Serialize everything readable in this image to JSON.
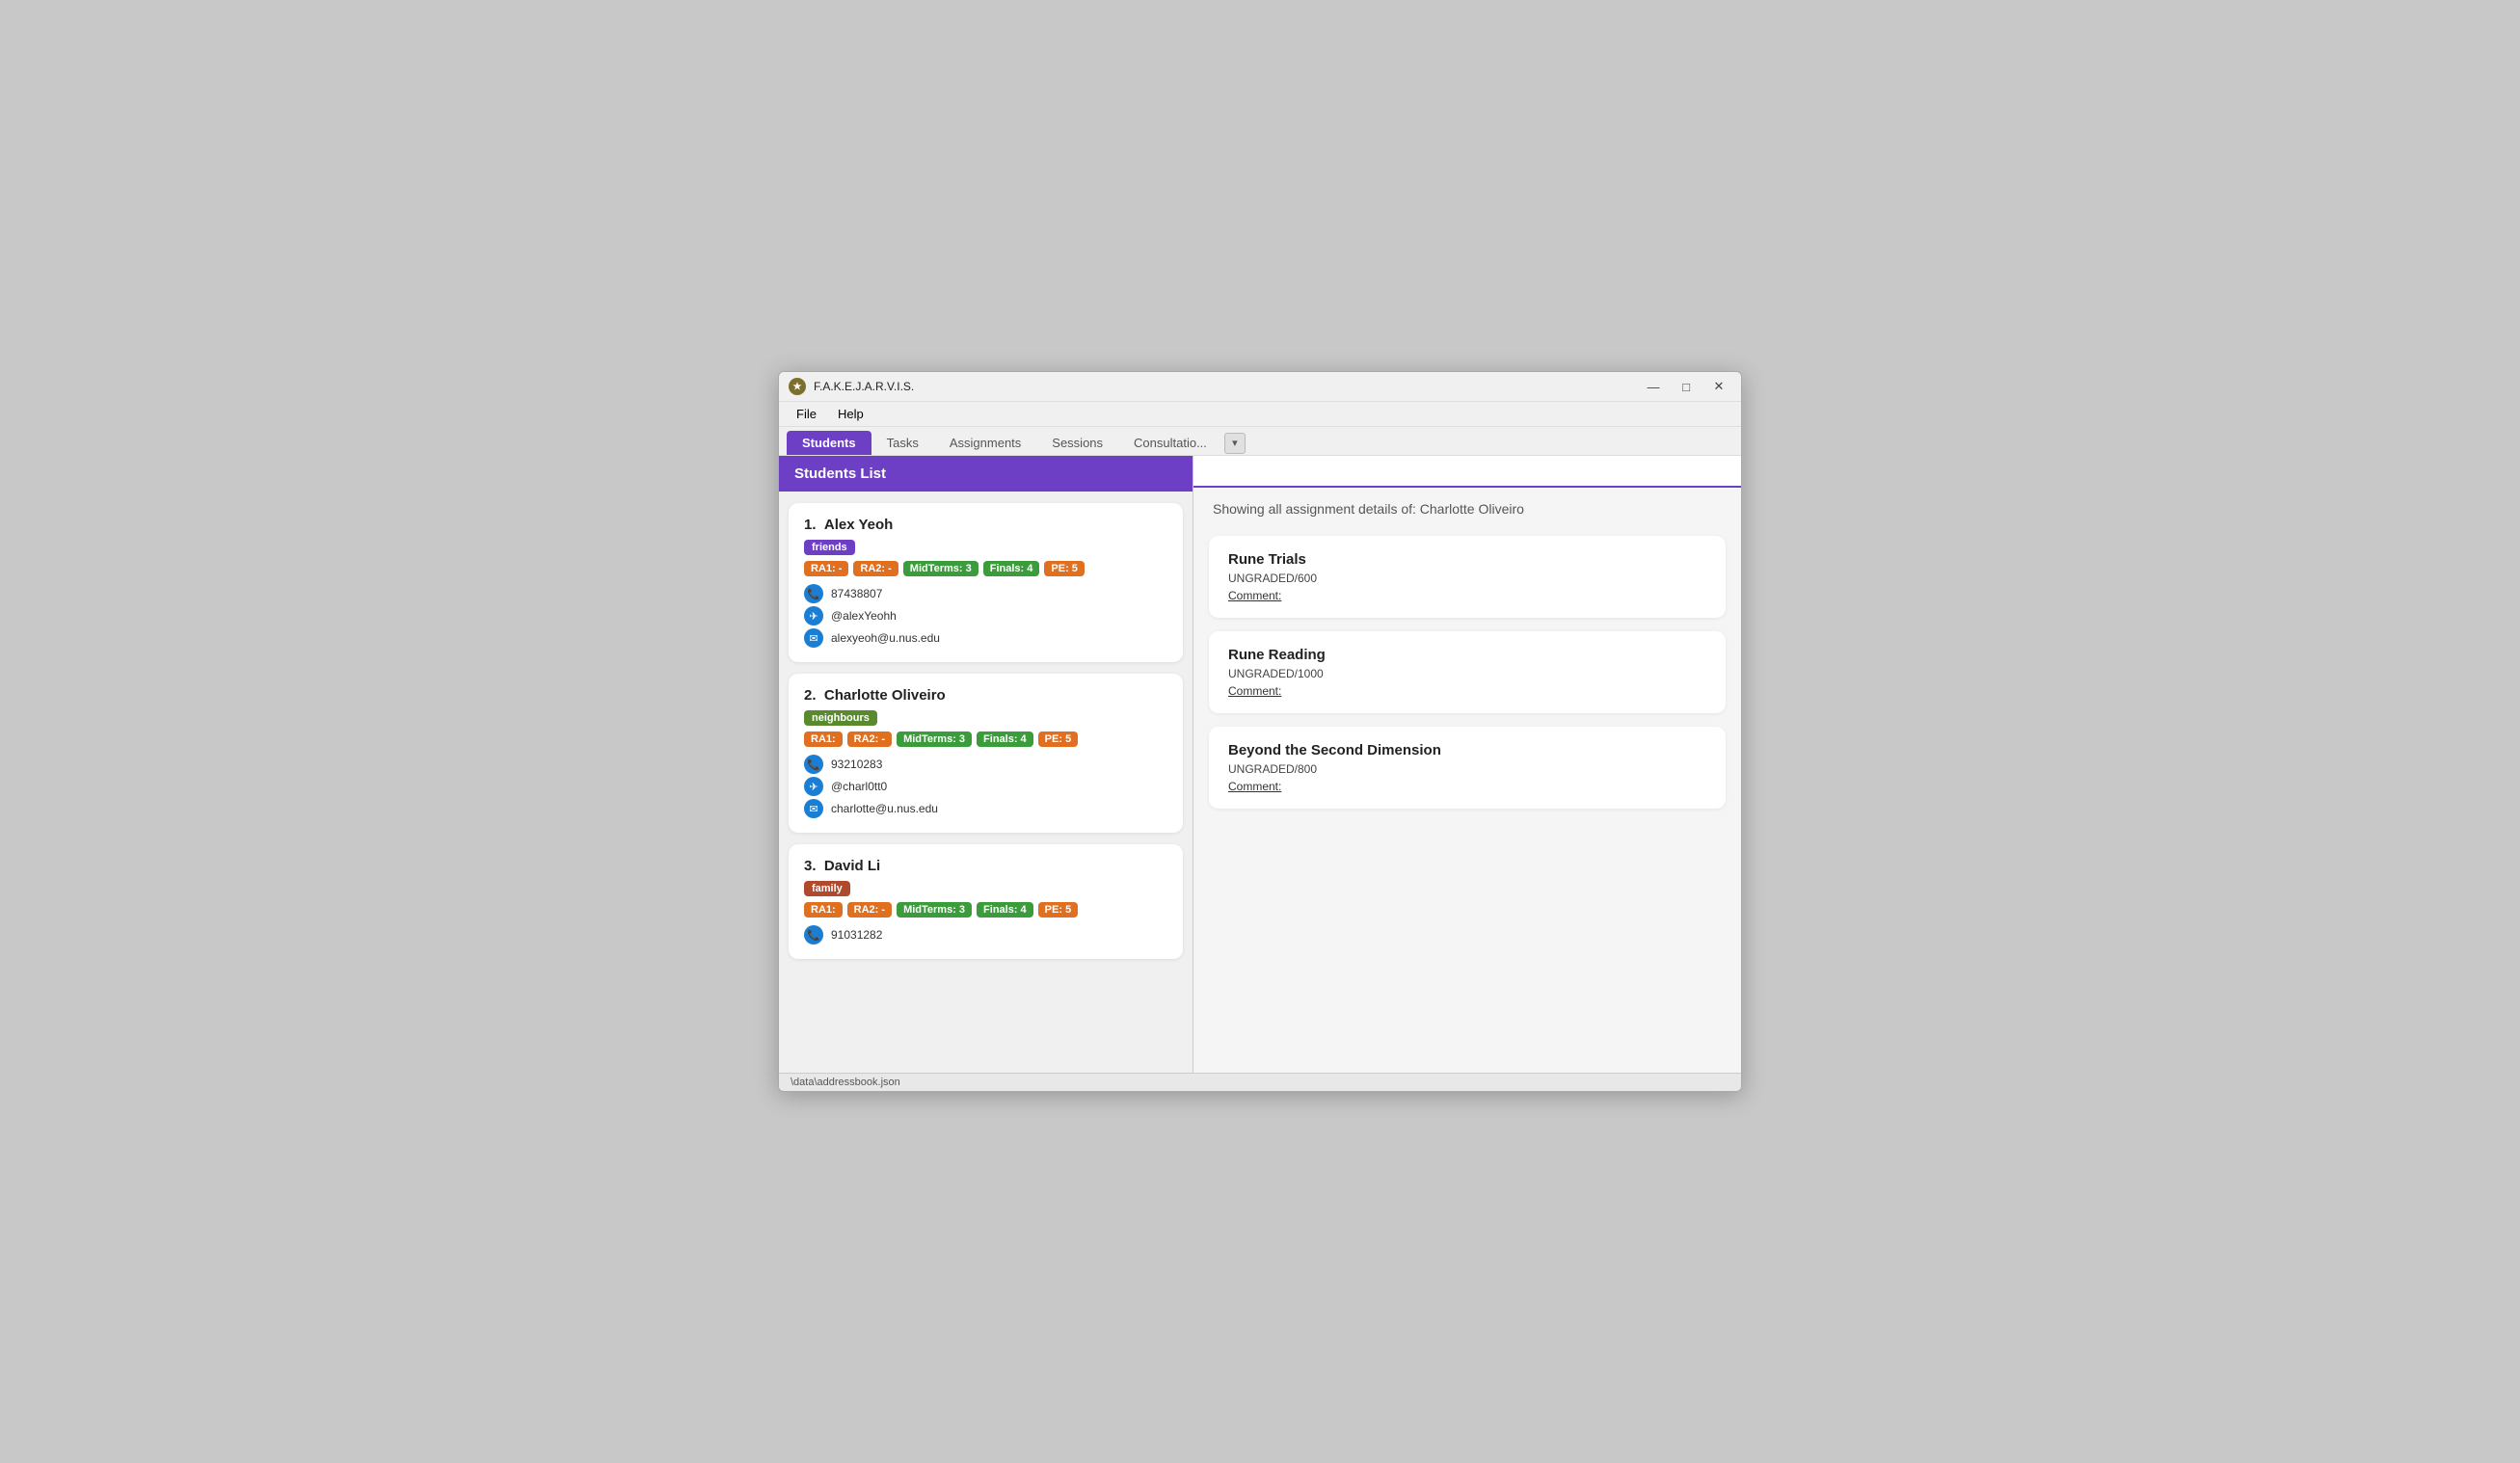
{
  "window": {
    "title": "F.A.K.E.J.A.R.V.I.S.",
    "icon": "★"
  },
  "titlebar": {
    "minimize": "—",
    "maximize": "□",
    "close": "✕"
  },
  "menu": {
    "items": [
      "File",
      "Help"
    ]
  },
  "tabs": {
    "items": [
      "Students",
      "Tasks",
      "Assignments",
      "Sessions",
      "Consultatio..."
    ],
    "active": "Students"
  },
  "leftPanel": {
    "header": "Students List",
    "students": [
      {
        "number": "1.",
        "name": "Alex Yeoh",
        "tag": "friends",
        "tagClass": "tag-friends",
        "scores": [
          {
            "label": "RA1: -",
            "class": "badge-orange"
          },
          {
            "label": "RA2: -",
            "class": "badge-orange"
          },
          {
            "label": "MidTerms: 3",
            "class": "badge-green"
          },
          {
            "label": "Finals: 4",
            "class": "badge-green"
          },
          {
            "label": "PE: 5",
            "class": "badge-orange"
          }
        ],
        "phone": "87438807",
        "telegram": "@alexYeohh",
        "email": "alexyeoh@u.nus.edu"
      },
      {
        "number": "2.",
        "name": "Charlotte Oliveiro",
        "tag": "neighbours",
        "tagClass": "tag-neighbours",
        "scores": [
          {
            "label": "RA1:",
            "class": "badge-orange"
          },
          {
            "label": "RA2: -",
            "class": "badge-orange"
          },
          {
            "label": "MidTerms: 3",
            "class": "badge-green"
          },
          {
            "label": "Finals: 4",
            "class": "badge-green"
          },
          {
            "label": "PE: 5",
            "class": "badge-orange"
          }
        ],
        "phone": "93210283",
        "telegram": "@charl0tt0",
        "email": "charlotte@u.nus.edu"
      },
      {
        "number": "3.",
        "name": "David Li",
        "tag": "family",
        "tagClass": "tag-family",
        "scores": [
          {
            "label": "RA1:",
            "class": "badge-orange"
          },
          {
            "label": "RA2: -",
            "class": "badge-orange"
          },
          {
            "label": "MidTerms: 3",
            "class": "badge-green"
          },
          {
            "label": "Finals: 4",
            "class": "badge-green"
          },
          {
            "label": "PE: 5",
            "class": "badge-orange"
          }
        ],
        "phone": "91031282",
        "telegram": "",
        "email": ""
      }
    ]
  },
  "rightPanel": {
    "searchPlaceholder": "",
    "assignmentInfoText": "Showing all assignment details of: Charlotte Oliveiro",
    "assignments": [
      {
        "title": "Rune Trials",
        "score": "UNGRADED/600",
        "comment": "Comment:"
      },
      {
        "title": "Rune Reading",
        "score": "UNGRADED/1000",
        "comment": "Comment:"
      },
      {
        "title": "Beyond the Second Dimension",
        "score": "UNGRADED/800",
        "comment": "Comment:"
      }
    ]
  },
  "statusBar": {
    "text": "\\data\\addressbook.json"
  }
}
